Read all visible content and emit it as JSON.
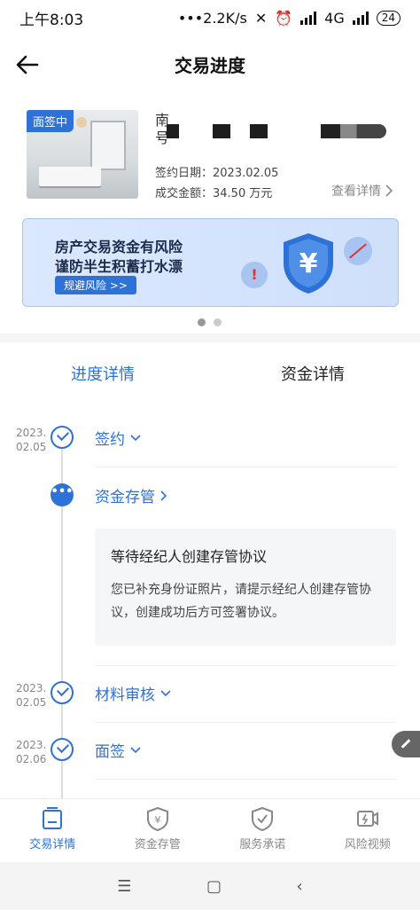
{
  "status": {
    "time": "上午8:03",
    "speed": "2.2K/s",
    "network": "4G",
    "battery": "24"
  },
  "nav": {
    "title": "交易进度"
  },
  "property": {
    "badge": "面签中",
    "addr_line1": "南",
    "addr_line2": "号",
    "sign_date": "签约日期：2023.02.05",
    "amount": "成交金额：34.50 万元",
    "detail_link": "查看详情"
  },
  "banner": {
    "line1": "房产交易资金有风险",
    "line2": "谨防半生积蓄打水漂",
    "button": "规避风险 >>",
    "shield_symbol": "¥"
  },
  "tabs": [
    {
      "label": "进度详情",
      "active": true
    },
    {
      "label": "资金详情",
      "active": false
    }
  ],
  "timeline": {
    "steps": [
      {
        "date_year": "2023.",
        "date_day": "02.05",
        "title": "签约",
        "status": "done"
      },
      {
        "date_year": "",
        "date_day": "",
        "title": "资金存管",
        "status": "current"
      },
      {
        "date_year": "2023.",
        "date_day": "02.05",
        "title": "材料审核",
        "status": "done"
      },
      {
        "date_year": "2023.",
        "date_day": "02.06",
        "title": "面签",
        "status": "done"
      }
    ],
    "notice": {
      "title": "等待经纪人创建存管协议",
      "body": "您已补充身份证照片，请提示经纪人创建存管协议，创建成功后方可签署协议。"
    }
  },
  "bottom_tabs": [
    {
      "label": "交易详情",
      "icon": "trash-doc-icon",
      "active": true
    },
    {
      "label": "资金存管",
      "icon": "yuan-shield-icon",
      "active": false
    },
    {
      "label": "服务承诺",
      "icon": "check-shield-icon",
      "active": false
    },
    {
      "label": "风险视频",
      "icon": "video-icon",
      "active": false
    }
  ],
  "colors": {
    "accent": "#2e72d8"
  }
}
